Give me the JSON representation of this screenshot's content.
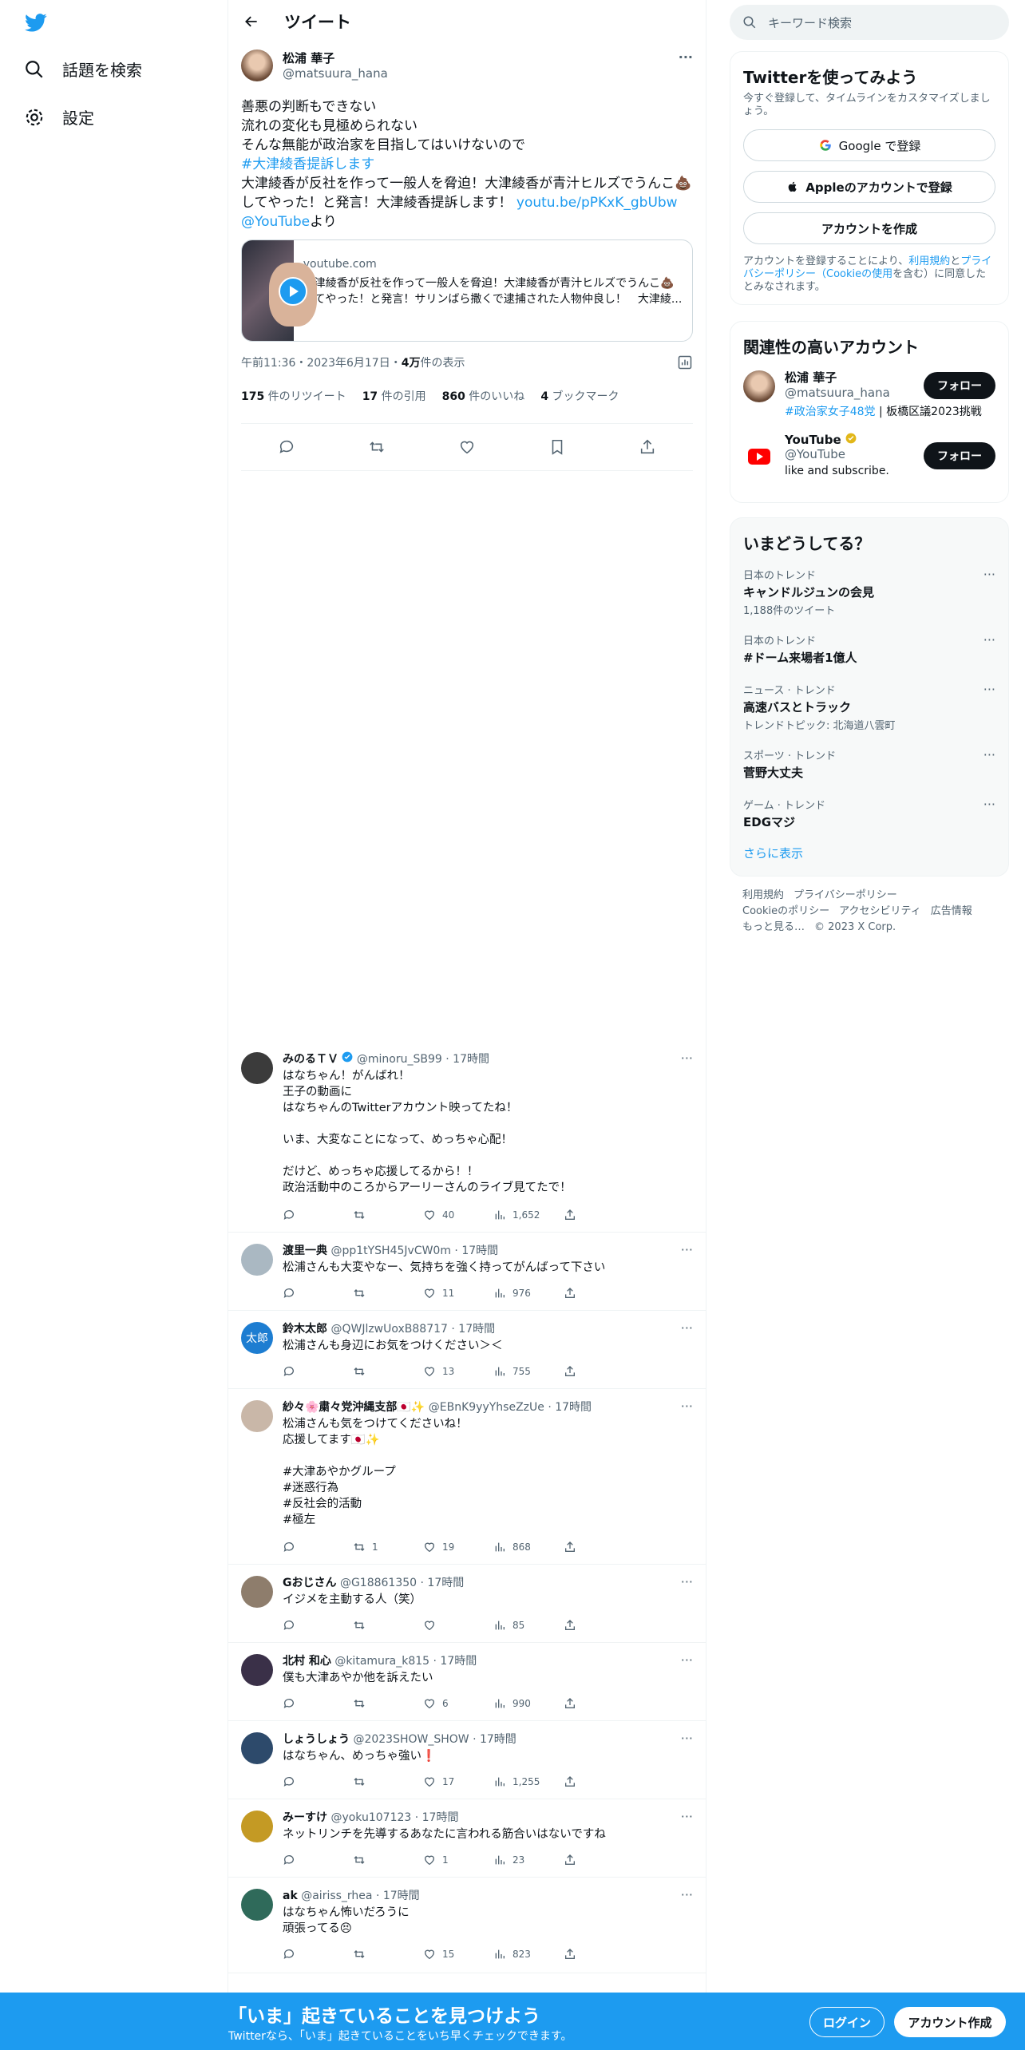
{
  "nav": {
    "explore": "話題を検索",
    "settings": "設定"
  },
  "header": {
    "title": "ツイート"
  },
  "tweet": {
    "name": "松浦 華子",
    "handle": "@matsuura_hana",
    "lines": [
      "善悪の判断もできない",
      "流れの変化も見極められない",
      "そんな無能が政治家を目指してはいけないので"
    ],
    "hashtag": "#大津綾香提訴します",
    "body2": "大津綾香が反社を作って一般人を脅迫！大津綾香が青汁ヒルズでうんこ💩してやった！と発言！大津綾香提訴します！",
    "link": "youtu.be/pPKxK_gbUbw",
    "mention": "@YouTube",
    "yori": "より",
    "card": {
      "domain": "youtube.com",
      "text": "大津綾香が反社を作って一般人を脅迫！大津綾香が青汁ヒルズでうんこ💩してやった！と発言！サリンばら撒くで逮捕された人物仲良し！　大津綾..."
    },
    "time": "午前11:36・2023年6月17日・",
    "views": "4万",
    "views_label": " 件の表示",
    "stats": [
      {
        "n": "175",
        "l": " 件のリツイート"
      },
      {
        "n": "17",
        "l": " 件の引用"
      },
      {
        "n": "860",
        "l": " 件のいいね"
      },
      {
        "n": "4",
        "l": " ブックマーク"
      }
    ]
  },
  "replies": [
    {
      "name": "みのるＴＶ",
      "handle": "@minoru_SB99 · 17時間",
      "text": "はなちゃん！がんばれ！\n王子の動画に\nはなちゃんのTwitterアカウント映ってたね！\n\nいま、大変なことになって、めっちゃ心配！\n\nだけど、めっちゃ応援してるから！！\n政治活動中のころからアーリーさんのライブ見てたで！",
      "rt": "",
      "like": "40",
      "views": "1,652",
      "color": "#3b3b3b"
    },
    {
      "name": "渡里一典",
      "handle": "@pp1tYSH45JvCW0m · 17時間",
      "text": "松浦さんも大変やなー、気持ちを強く持ってがんばって下さい",
      "rt": "",
      "like": "11",
      "views": "976",
      "color": "#aab8c2"
    },
    {
      "name": "鈴木太郎",
      "handle": "@QWJlzwUoxB88717 · 17時間",
      "text": "松浦さんも身辺にお気をつけください＞＜",
      "rt": "",
      "like": "13",
      "views": "755",
      "color": "#1d7dd1",
      "initial": "太郎"
    },
    {
      "name": "紗々🌸粛々党沖縄支部🇯🇵✨",
      "handle": "@EBnK9yyYhseZzUe · 17時間",
      "text": "松浦さんも気をつけてくださいね！\n応援してます🇯🇵✨\n\n#大津あやかグループ\n#迷惑行為\n#反社会的活動\n#極左",
      "rt": "1",
      "like": "19",
      "views": "868",
      "color": "#c9b7a8"
    },
    {
      "name": "Gおじさん",
      "handle": "@G18861350 · 17時間",
      "text": "イジメを主動する人（笑）",
      "rt": "",
      "like": "",
      "views": "85",
      "color": "#8e7d6c"
    },
    {
      "name": "北村 和心",
      "handle": "@kitamura_k815 · 17時間",
      "text": "僕も大津あやか他を訴えたい",
      "rt": "",
      "like": "6",
      "views": "990",
      "color": "#3a3048"
    },
    {
      "name": "しょうしょう",
      "handle": "@2023SHOW_SHOW · 17時間",
      "text": "はなちゃん、めっちゃ強い❗",
      "rt": "",
      "like": "17",
      "views": "1,255",
      "color": "#2d4a6b"
    },
    {
      "name": "みーすけ",
      "handle": "@yoku107123 · 17時間",
      "text": "ネットリンチを先導するあなたに言われる筋合いはないですね",
      "rt": "",
      "like": "1",
      "views": "23",
      "color": "#c49a24"
    },
    {
      "name": "ak",
      "handle": "@airiss_rhea · 17時間",
      "text": "はなちゃん怖いだろうに\n頑張ってる😣",
      "rt": "",
      "like": "15",
      "views": "823",
      "color": "#2f6a5a"
    }
  ],
  "right": {
    "search_placeholder": "キーワード検索",
    "signup": {
      "title": "Twitterを使ってみよう",
      "sub": "今すぐ登録して、タイムラインをカスタマイズしましょう。",
      "google": "Google で登録",
      "apple": "Appleのアカウントで登録",
      "create": "アカウントを作成",
      "legal_a": "アカウントを登録することにより、",
      "legal_terms": "利用規約",
      "legal_b": "と",
      "legal_privacy": "プライバシーポリシー（Cookieの使用",
      "legal_c": "を含む）に同意したとみなされます。"
    },
    "related": {
      "title": "関連性の高いアカウント",
      "accounts": [
        {
          "name": "松浦 華子",
          "handle": "@matsuura_hana",
          "bio_tag": "#政治家女子48党",
          "bio_rest": " | 板橋区議2023挑戦",
          "follow": "フォロー"
        },
        {
          "name": "YouTube",
          "handle": "@YouTube",
          "bio_tag": "",
          "bio_rest": "like and subscribe.",
          "follow": "フォロー"
        }
      ]
    },
    "trends": {
      "title": "いまどうしてる？",
      "items": [
        {
          "cat": "日本のトレンド",
          "name": "キャンドルジュンの会見",
          "count": "1,188件のツイート"
        },
        {
          "cat": "日本のトレンド",
          "name": "#ドーム来場者1億人",
          "count": ""
        },
        {
          "cat": "ニュース · トレンド",
          "name": "高速バスとトラック",
          "count": "トレンドトピック: 北海道八雲町"
        },
        {
          "cat": "スポーツ · トレンド",
          "name": "菅野大丈夫",
          "count": ""
        },
        {
          "cat": "ゲーム · トレンド",
          "name": "EDGマジ",
          "count": ""
        }
      ],
      "more": "さらに表示"
    },
    "footer": [
      "利用規約",
      "プライバシーポリシー",
      "Cookieのポリシー",
      "アクセシビリティ",
      "広告情報",
      "もっと見る…",
      "© 2023 X Corp."
    ]
  },
  "banner": {
    "title": "「いま」起きていることを見つけよう",
    "sub": "Twitterなら、「いま」起きていることをいち早くチェックできます。",
    "login": "ログイン",
    "signup": "アカウント作成"
  }
}
